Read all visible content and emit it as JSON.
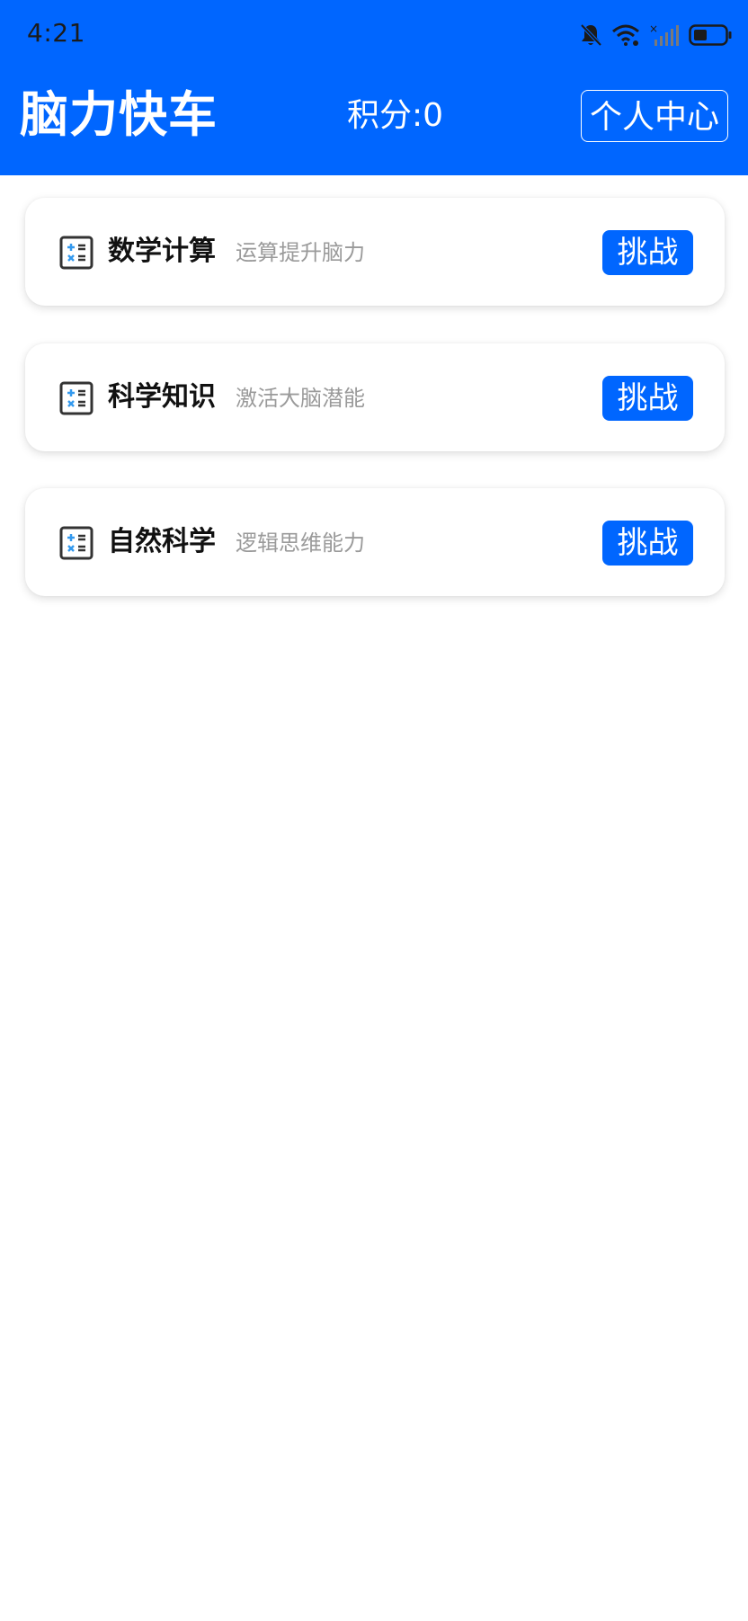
{
  "status_bar": {
    "time": "4:21",
    "icons": [
      "bell-off-icon",
      "wifi-icon",
      "signal-off-icon",
      "battery-icon"
    ]
  },
  "header": {
    "title": "脑力快车",
    "score_label": "积分:0",
    "profile_button": "个人中心"
  },
  "colors": {
    "primary": "#0066ff",
    "subtitle": "#9a9a9a",
    "icon_accent": "#3399ee"
  },
  "categories": [
    {
      "icon": "calculator-icon",
      "title": "数学计算",
      "subtitle": "运算提升脑力",
      "button": "挑战"
    },
    {
      "icon": "calculator-icon",
      "title": "科学知识",
      "subtitle": "激活大脑潜能",
      "button": "挑战"
    },
    {
      "icon": "calculator-icon",
      "title": "自然科学",
      "subtitle": "逻辑思维能力",
      "button": "挑战"
    }
  ]
}
